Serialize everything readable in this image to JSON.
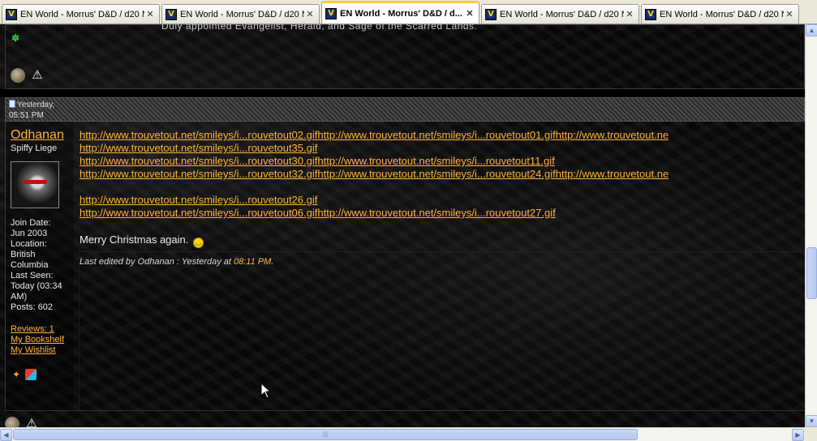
{
  "tabs": [
    {
      "label": "EN World - Morrus' D&D / d20 Ne...",
      "active": false
    },
    {
      "label": "EN World - Morrus' D&D / d20 Ne...",
      "active": false
    },
    {
      "label": "EN World - Morrus' D&D / d...",
      "active": true
    },
    {
      "label": "EN World - Morrus' D&D / d20 Ne...",
      "active": false
    },
    {
      "label": "EN World - Morrus' D&D / d20 Ne...",
      "active": false
    }
  ],
  "tab_favicon_glyph": "V",
  "tab_close_glyph": "✕",
  "previous_post": {
    "signature": "Duly appointed Evangelist, Herald, and Sage of the Scarred Lands."
  },
  "post": {
    "date_line1": "Yesterday,",
    "date_line2": "05:51 PM",
    "username": "Odhanan",
    "user_title": "Spiffy Liege",
    "join_label": "Join Date:",
    "join_value": "Jun 2003",
    "location_label": "Location:",
    "location_value": "British Columbia",
    "last_seen_label": "Last Seen:",
    "last_seen_value": "Today (03:34 AM)",
    "posts": "Posts: 602",
    "user_links": [
      "Reviews: 1",
      "My Bookshelf",
      "My Wishlist"
    ],
    "links": [
      "http://www.trouvetout.net/smileys/i...rouvetout02.gifhttp://www.trouvetout.net/smileys/i...rouvetout01.gifhttp://www.trouvetout.ne",
      "http://www.trouvetout.net/smileys/i...rouvetout35.gif",
      "http://www.trouvetout.net/smileys/i...rouvetout30.gifhttp://www.trouvetout.net/smileys/i...rouvetout11.gif",
      "http://www.trouvetout.net/smileys/i...rouvetout32.gifhttp://www.trouvetout.net/smileys/i...rouvetout24.gifhttp://www.trouvetout.ne",
      "",
      "http://www.trouvetout.net/smileys/i...rouvetout26.gif",
      "http://www.trouvetout.net/smileys/i...rouvetout06.gifhttp://www.trouvetout.net/smileys/i...rouvetout27.gif"
    ],
    "message_text": "Merry Christmas again.",
    "edited_prefix": "Last edited by Odhanan : Yesterday at ",
    "edited_time": "08:11 PM",
    "edited_suffix": "."
  },
  "colors": {
    "link": "#ffb33c",
    "background": "#050505",
    "tab_active_accent": "#ffc83c"
  },
  "icons": {
    "green": "green-flower-icon",
    "reputation": "reputation-icon",
    "report": "report-warning-icon",
    "aim": "aim-icon",
    "msn": "msn-icon"
  }
}
